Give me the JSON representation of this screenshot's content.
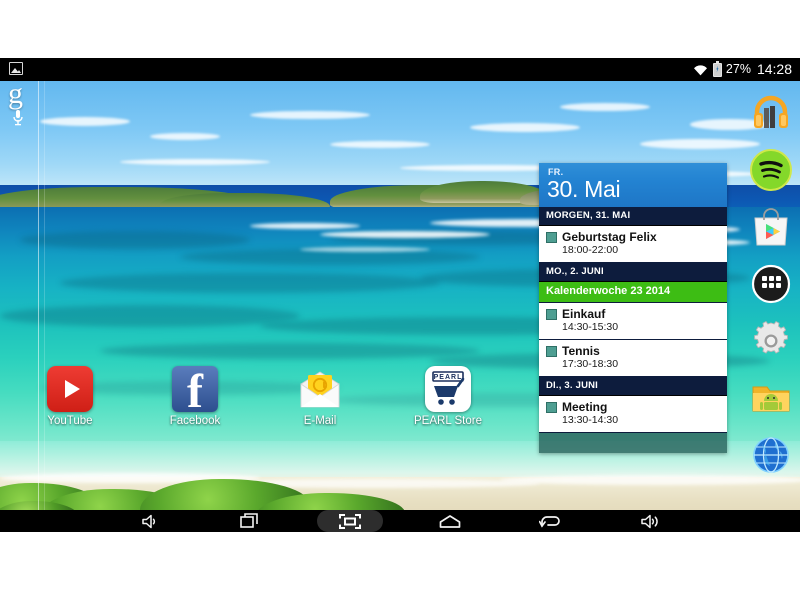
{
  "status_bar": {
    "left_icon": "screenshot-image-icon",
    "wifi_icon": "wifi-icon",
    "battery_icon": "battery-charging-icon",
    "battery_percent": "27%",
    "clock": "14:28"
  },
  "search_widget": {
    "logo_text": "g",
    "mic_icon": "microphone-icon"
  },
  "home_apps": [
    {
      "label": "YouTube",
      "icon": "youtube-icon"
    },
    {
      "label": "Facebook",
      "icon": "facebook-icon"
    },
    {
      "label": "E-Mail",
      "icon": "email-envelope-icon"
    },
    {
      "label": "PEARL Store",
      "icon": "pearl-store-icon"
    }
  ],
  "sidebar": {
    "items": [
      {
        "name": "play-music",
        "icon": "headphones-icon"
      },
      {
        "name": "spotify",
        "icon": "spotify-icon"
      },
      {
        "name": "play-store",
        "icon": "play-store-bag-icon"
      },
      {
        "name": "app-drawer",
        "icon": "apps-grid-icon"
      },
      {
        "name": "settings",
        "icon": "gear-icon"
      },
      {
        "name": "file-manager",
        "icon": "folder-android-icon"
      },
      {
        "name": "browser",
        "icon": "globe-icon"
      }
    ]
  },
  "calendar_widget": {
    "weekday": "FR.",
    "date": "30. Mai",
    "sections": [
      {
        "day_label": "MORGEN, 31. MAI",
        "week_banner": null,
        "events": [
          {
            "title": "Geburtstag Felix",
            "time": "18:00-22:00",
            "color": "#4e9e92"
          }
        ]
      },
      {
        "day_label": "MO., 2. JUNI",
        "week_banner": "Kalenderwoche 23 2014",
        "events": [
          {
            "title": "Einkauf",
            "time": "14:30-15:30",
            "color": "#4e9e92"
          },
          {
            "title": "Tennis",
            "time": "17:30-18:30",
            "color": "#4e9e92"
          }
        ]
      },
      {
        "day_label": "DI., 3. JUNI",
        "week_banner": null,
        "events": [
          {
            "title": "Meeting",
            "time": "13:30-14:30",
            "color": "#4e9e92"
          }
        ]
      }
    ]
  },
  "nav_bar": {
    "buttons": [
      {
        "name": "volume-down",
        "icon": "volume-down-icon",
        "active": false
      },
      {
        "name": "recent-apps",
        "icon": "recent-apps-icon",
        "active": false
      },
      {
        "name": "screenshot",
        "icon": "screenshot-icon",
        "active": true
      },
      {
        "name": "home",
        "icon": "home-icon",
        "active": false
      },
      {
        "name": "back",
        "icon": "back-arrow-icon",
        "active": false
      },
      {
        "name": "volume-up",
        "icon": "volume-up-icon",
        "active": false
      }
    ]
  },
  "colors": {
    "status_bar_bg": "#000000",
    "nav_bar_bg": "#000000",
    "cal_header_blue": "#2383d2",
    "cal_daybar_navy": "#0d1c3d",
    "cal_week_green": "#3dbd14",
    "event_swatch": "#4e9e92",
    "page_bg": "#ffffff"
  }
}
